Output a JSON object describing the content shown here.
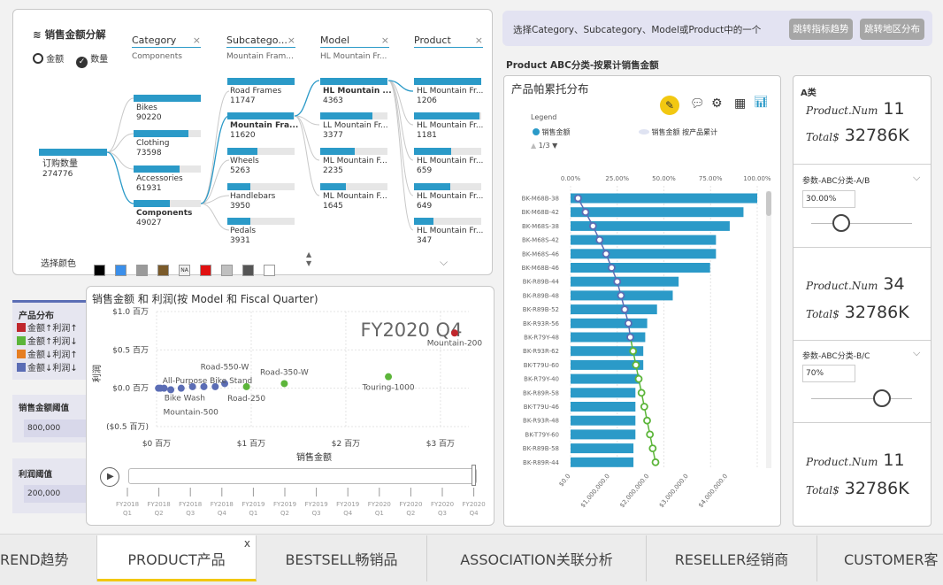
{
  "decomp": {
    "title": "销售金额分解",
    "radio_amount": "金额",
    "radio_count": "数量",
    "root_label": "订购数量",
    "root_value": "274776",
    "columns": [
      {
        "label": "Category",
        "selected": "Components"
      },
      {
        "label": "Subcatego...",
        "selected": "Mountain Fram..."
      },
      {
        "label": "Model",
        "selected": "HL Mountain Fr..."
      },
      {
        "label": "Product",
        "selected": ""
      }
    ],
    "category_nodes": [
      {
        "label": "Bikes",
        "value": "90220",
        "fill": 1.0
      },
      {
        "label": "Clothing",
        "value": "73598",
        "fill": 0.82
      },
      {
        "label": "Accessories",
        "value": "61931",
        "fill": 0.69
      },
      {
        "label": "Components",
        "value": "49027",
        "fill": 0.54
      }
    ],
    "subcat_nodes": [
      {
        "label": "Road Frames",
        "value": "11747",
        "fill": 1.0
      },
      {
        "label": "Mountain Fra...",
        "value": "11620",
        "fill": 0.99
      },
      {
        "label": "Wheels",
        "value": "5263",
        "fill": 0.45
      },
      {
        "label": "Handlebars",
        "value": "3950",
        "fill": 0.34
      },
      {
        "label": "Pedals",
        "value": "3931",
        "fill": 0.34
      }
    ],
    "model_nodes": [
      {
        "label": "HL Mountain ...",
        "value": "4363",
        "fill": 1.0
      },
      {
        "label": "LL Mountain Fr...",
        "value": "3377",
        "fill": 0.77
      },
      {
        "label": "ML Mountain F...",
        "value": "2235",
        "fill": 0.51
      },
      {
        "label": "ML Mountain F...",
        "value": "1645",
        "fill": 0.38
      }
    ],
    "product_nodes": [
      {
        "label": "HL Mountain Fr...",
        "value": "1206",
        "fill": 1.0
      },
      {
        "label": "HL Mountain Fr...",
        "value": "1181",
        "fill": 0.98
      },
      {
        "label": "HL Mountain Fr...",
        "value": "659",
        "fill": 0.55
      },
      {
        "label": "HL Mountain Fr...",
        "value": "649",
        "fill": 0.54
      },
      {
        "label": "HL Mountain Fr...",
        "value": "347",
        "fill": 0.29
      }
    ],
    "color_label": "选择颜色",
    "color_swatches": [
      "#000000",
      "#3b8fea",
      "#9a9a9a",
      "#7a5a2a",
      "NA",
      "#e01010",
      "#c0c0c0",
      "#555555",
      "#ffffff"
    ]
  },
  "filter_bar": {
    "text": "选择Category、Subcategory、Model或Product中的一个",
    "btn_trend": "跳转指标趋势",
    "btn_region": "跳转地区分布"
  },
  "pareto": {
    "section_title": "Product ABC分类-按累计销售金额",
    "title": "产品帕累托分布",
    "legend_title": "Legend",
    "legend_bar": "销售金额",
    "legend_line": "销售金额 按产品累计",
    "legend_page": "1/3",
    "top_ticks": [
      "0.00%",
      "25.00%",
      "50.00%",
      "75.00%",
      "100.00%"
    ],
    "bottom_ticks": [
      "$0.0",
      "$1,000,000.0",
      "$2,000,000.0",
      "$3,000,000.0",
      "$4,000,000.0"
    ]
  },
  "chart_data": [
    {
      "type": "bar",
      "title": "产品帕累托分布",
      "categories": [
        "BK-M68B-38",
        "BK-M68B-42",
        "BK-M68S-38",
        "BK-M68S-42",
        "BK-M68S-46",
        "BK-M68B-46",
        "BK-R89B-44",
        "BK-R89B-48",
        "BK-R89B-52",
        "BK-R93R-56",
        "BK-R79Y-48",
        "BK-R93R-62",
        "BK-T79U-60",
        "BK-R79Y-40",
        "BK-R89R-58",
        "BK-T79U-46",
        "BK-R93R-48",
        "BK-T79Y-60",
        "BK-R89B-58",
        "BK-R89R-44"
      ],
      "series": [
        {
          "name": "销售金额",
          "values": [
            4750000,
            4400000,
            4050000,
            3700000,
            3700000,
            3550000,
            2750000,
            2600000,
            2200000,
            1950000,
            1900000,
            1850000,
            1850000,
            1750000,
            1650000,
            1650000,
            1650000,
            1650000,
            1600000,
            1600000
          ]
        },
        {
          "name": "销售金额 按产品累计",
          "values": [
            0.04,
            0.08,
            0.12,
            0.155,
            0.19,
            0.22,
            0.25,
            0.27,
            0.29,
            0.31,
            0.32,
            0.335,
            0.35,
            0.365,
            0.38,
            0.395,
            0.41,
            0.425,
            0.44,
            0.455
          ]
        }
      ],
      "xlim": [
        0,
        4750000
      ]
    },
    {
      "type": "scatter",
      "title": "销售金额 和 利润(按 Model 和 Fiscal Quarter)",
      "xlabel": "销售金额",
      "ylabel": "利润",
      "x_ticks": [
        "$0 百万",
        "$1 百万",
        "$2 百万",
        "$3 百万"
      ],
      "y_ticks": [
        "$1.0 百万",
        "$0.5 百万",
        "$0.0 百万",
        "($0.5 百万)"
      ],
      "xlim": [
        0,
        3.3
      ],
      "ylim": [
        -0.5,
        1.0
      ],
      "play_label": "FY2020 Q4",
      "points": [
        {
          "x": 3.15,
          "y": 0.72,
          "label": "Mountain-200",
          "color": "#c0272d"
        },
        {
          "x": 2.45,
          "y": 0.15,
          "label": "Touring-1000",
          "color": "#5cb53a"
        },
        {
          "x": 1.35,
          "y": 0.06,
          "label": "Road-350-W",
          "color": "#5cb53a"
        },
        {
          "x": 0.95,
          "y": 0.02,
          "label": "Road-250",
          "color": "#5cb53a"
        },
        {
          "x": 0.72,
          "y": 0.06,
          "label": "Road-550-W",
          "color": "#5b6db5"
        },
        {
          "x": 0.62,
          "y": 0.02,
          "label": "",
          "color": "#5b6db5"
        },
        {
          "x": 0.5,
          "y": 0.02,
          "label": "All-Purpose Bike Stand",
          "color": "#5b6db5"
        },
        {
          "x": 0.38,
          "y": 0.02,
          "label": "",
          "color": "#5b6db5"
        },
        {
          "x": 0.26,
          "y": 0.0,
          "label": "Bike Wash",
          "color": "#5b6db5"
        },
        {
          "x": 0.15,
          "y": -0.02,
          "label": "",
          "color": "#5b6db5"
        },
        {
          "x": 0.08,
          "y": 0.0,
          "label": "Mountain-500",
          "color": "#5b6db5"
        },
        {
          "x": 0.04,
          "y": 0.0,
          "label": "",
          "color": "#5b6db5"
        },
        {
          "x": 0.02,
          "y": 0.0,
          "label": "",
          "color": "#5b6db5"
        }
      ]
    }
  ],
  "scatter_timeline": [
    "FY2018 Q1",
    "FY2018 Q2",
    "FY2018 Q3",
    "FY2018 Q4",
    "FY2019 Q1",
    "FY2019 Q2",
    "FY2019 Q3",
    "FY2019 Q4",
    "FY2020 Q1",
    "FY2020 Q2",
    "FY2020 Q3",
    "FY2020 Q4"
  ],
  "left_legend": {
    "title": "产品分布",
    "items": [
      {
        "label": "金额↑利润↑",
        "color": "#c0272d"
      },
      {
        "label": "金额↑利润↓",
        "color": "#5cb53a"
      },
      {
        "label": "金额↓利润↑",
        "color": "#e67e22"
      },
      {
        "label": "金额↓利润↓",
        "color": "#5b6db5"
      }
    ],
    "sales_threshold_label": "销售金额阈值",
    "sales_threshold_value": "800,000",
    "profit_threshold_label": "利润阈值",
    "profit_threshold_value": "200,000"
  },
  "abc": {
    "a_title": "A类",
    "num_label": "Product.Num",
    "total_label": "Total$",
    "a_num": "11",
    "a_total": "32786K",
    "param_ab_label": "参数-ABC分类-A/B",
    "param_ab_value": "30.00%",
    "param_ab_level": 0.3,
    "b_num": "34",
    "b_total": "32786K",
    "param_bc_label": "参数-ABC分类-B/C",
    "param_bc_value": "70%",
    "param_bc_level": 0.7,
    "c_num": "11",
    "c_total": "32786K"
  },
  "tabs": [
    {
      "label": "REND趋势",
      "active": false
    },
    {
      "label": "PRODUCT产品",
      "active": true
    },
    {
      "label": "BESTSELL畅销品",
      "active": false
    },
    {
      "label": "ASSOCIATION关联分析",
      "active": false
    },
    {
      "label": "RESELLER经销商",
      "active": false
    },
    {
      "label": "CUSTOMER客",
      "active": false
    }
  ],
  "tab_close": "x"
}
